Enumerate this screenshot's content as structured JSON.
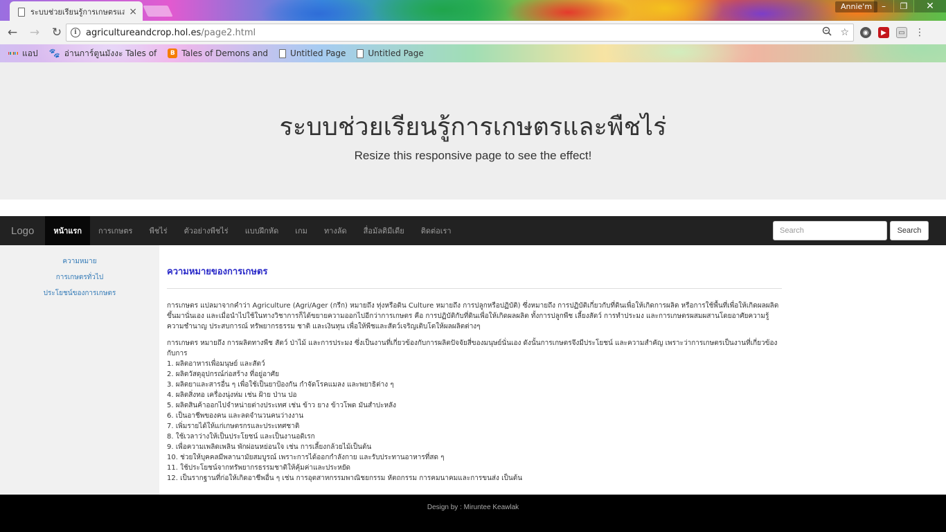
{
  "browser": {
    "tab_title": "ระบบช่วยเรียนรู้การเกษตรและ",
    "profile_name": "Annie'm",
    "url_host": "agricultureandcrop.hol.es",
    "url_path": "/page2.html",
    "bookmarks": [
      {
        "label": "แอป",
        "icon": "apps-grid-icon"
      },
      {
        "label": "อ่านการ์ตูนมังงะ Tales of",
        "icon": "paw-icon"
      },
      {
        "label": "Tales of Demons and",
        "icon": "blogger-icon"
      },
      {
        "label": "Untitled Page",
        "icon": "page-icon"
      },
      {
        "label": "Untitled Page",
        "icon": "page-icon"
      }
    ]
  },
  "header": {
    "title": "ระบบช่วยเรียนรู้การเกษตรและพืชไร่",
    "subtitle": "Resize this responsive page to see the effect!"
  },
  "navbar": {
    "brand": "Logo",
    "items": [
      "หน้าแรก",
      "การเกษตร",
      "พืชไร่",
      "ตัวอย่างพืชไร่",
      "แบบฝึกหัด",
      "เกม",
      "ทางลัด",
      "สื่อมัลติมีเดีย",
      "ติดต่อเรา"
    ],
    "active_index": 0,
    "search_placeholder": "Search",
    "search_button": "Search"
  },
  "sidebar": {
    "links": [
      "ความหมาย",
      "การเกษตรทั่วไป",
      "ประโยชน์ของการเกษตร"
    ]
  },
  "content": {
    "title": "ความหมายของการเกษตร",
    "paragraph1": "การเกษตร แปลมาจากคำว่า Agriculture (Agri/Ager (กรีก) หมายถึง ทุ่งหรือดิน Culture หมายถึง การปลูกหรือปฏิบัติ) ซึ่งหมายถึง การปฏิบัติเกี่ยวกับที่ดินเพื่อให้เกิดการผลิต หรือการใช้พื้นที่เพื่อให้เกิดผลผลิตขึ้นมานั่นเอง และเมื่อนำไปใช้ในทางวิชาการก็ได้ขยายความออกไปอีกว่าการเกษตร คือ การปฏิบัติกับที่ดินเพื่อให้เกิดผลผลิต ทั้งการปลูกพืช เลี้ยงสัตว์ การทำประมง และการเกษตรผสมผสานโดยอาศัยความรู้ ความชำนาญ ประสบการณ์ ทรัพยากรธรรม ชาติ และเงินทุน เพื่อให้พืชและสัตว์เจริญเติบโตให้ผลผลิตต่างๆ",
    "paragraph2": "การเกษตร หมายถึง การผลิตทางพืช สัตว์ ป่าไม้ และการประมง ซึ่งเป็นงานที่เกี่ยวข้องกับการผลิตปัจจัยสี่ของมนุษย์นั่นเอง ดังนั้นการเกษตรจึงมีประโยชน์ และความสำคัญ เพราะว่าการเกษตรเป็นงานที่เกี่ยวข้องกับการ",
    "benefits": [
      "1. ผลิตอาหารเพื่อมนุษย์ และสัตว์",
      "2. ผลิตวัสดุอุปกรณ์ก่อสร้าง ที่อยู่อาศัย",
      "3. ผลิตยาและสารอื่น ๆ เพื่อใช้เป็นยาป้องกัน กำจัดโรคแมลง และพยาธิต่าง ๆ",
      "4. ผลิตสิ่งทอ เครื่องนุ่งห่ม เช่น ฝ้าย ป่าน ปอ",
      "5. ผลิตสินค้าออกไปจำหน่ายต่างประเทศ เช่น ข้าว ยาง ข้าวโพด มันสำปะหลัง",
      "6. เป็นอาชีพของคน และลดจำนวนคนว่างงาน",
      "7. เพิ่มรายได้ให้แก่เกษตรกรและประเทศชาติ",
      "8. ใช้เวลาว่างให้เป็นประโยชน์ และเป็นงานอดิเรก",
      "9. เพื่อความเพลิดเพลิน พักผ่อนหย่อนใจ เช่น การเลี้ยงกล้วยไม้เป็นต้น",
      "10. ช่วยให้บุคคลมีพลานามัยสมบูรณ์ เพราะการได้ออกกำลังกาย และรับประทานอาหารที่สด ๆ",
      "11. ใช้ประโยชน์จากทรัพยากรธรรมชาติให้คุ้มค่าและประหยัด",
      "12. เป็นรากฐานที่ก่อให้เกิดอาชีพอื่น ๆ เช่น การอุตสาหกรรมพาณิชยกรรม หัตถกรรม การคมนาคมและการขนส่ง เป็นต้น"
    ]
  },
  "footer": {
    "text": "Design by : Miruntee Keawlak"
  }
}
